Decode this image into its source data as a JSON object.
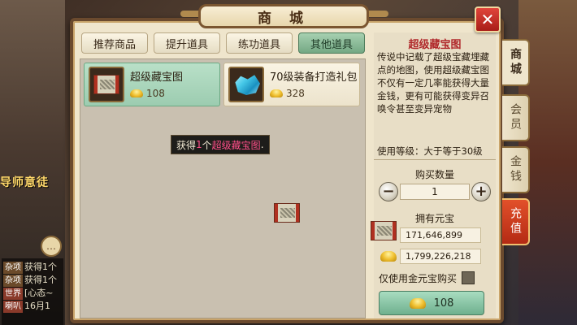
{
  "background": {
    "npc_label": "导师意徒",
    "chat_lines": [
      {
        "tag": "杂项",
        "text": "获得1个"
      },
      {
        "tag": "杂项",
        "text": "获得1个"
      },
      {
        "tag": "世界",
        "text": "[心态~"
      },
      {
        "tag": "喇叭",
        "text": "16月1"
      }
    ]
  },
  "shop": {
    "title": "商 城",
    "close_label": "✕",
    "tabs": [
      {
        "label": "推荐商品",
        "active": false
      },
      {
        "label": "提升道具",
        "active": false
      },
      {
        "label": "练功道具",
        "active": false
      },
      {
        "label": "其他道具",
        "active": true
      }
    ],
    "items": [
      {
        "name": "超级藏宝图",
        "price": "108",
        "icon": "treasure-map-icon",
        "selected": true
      },
      {
        "name": "70级装备打造礼包",
        "price": "328",
        "icon": "crystal-pack-icon",
        "selected": false
      }
    ],
    "toast": {
      "prefix": "获得",
      "count": "1",
      "unit": "个",
      "item": "超级藏宝图",
      "suffix": "."
    },
    "detail": {
      "title": "超级藏宝图",
      "description": "传说中记载了超级宝藏埋藏点的地图，使用超级藏宝图不仅有一定几率能获得大量金钱，更有可能获得变异召唤令甚至变异宠物",
      "level_req": "使用等级：大于等于30级",
      "qty_label": "购买数量",
      "qty_value": "1",
      "own_label": "拥有元宝",
      "balance_1": "171,646,899",
      "balance_2": "1,799,226,218",
      "only_gold_label": "仅使用金元宝购买",
      "buy_price": "108"
    },
    "side_tabs": [
      {
        "label": "商城",
        "active": true
      },
      {
        "label": "会员",
        "active": false
      },
      {
        "label": "金钱",
        "active": false
      },
      {
        "label": "充值",
        "active": false
      }
    ]
  }
}
